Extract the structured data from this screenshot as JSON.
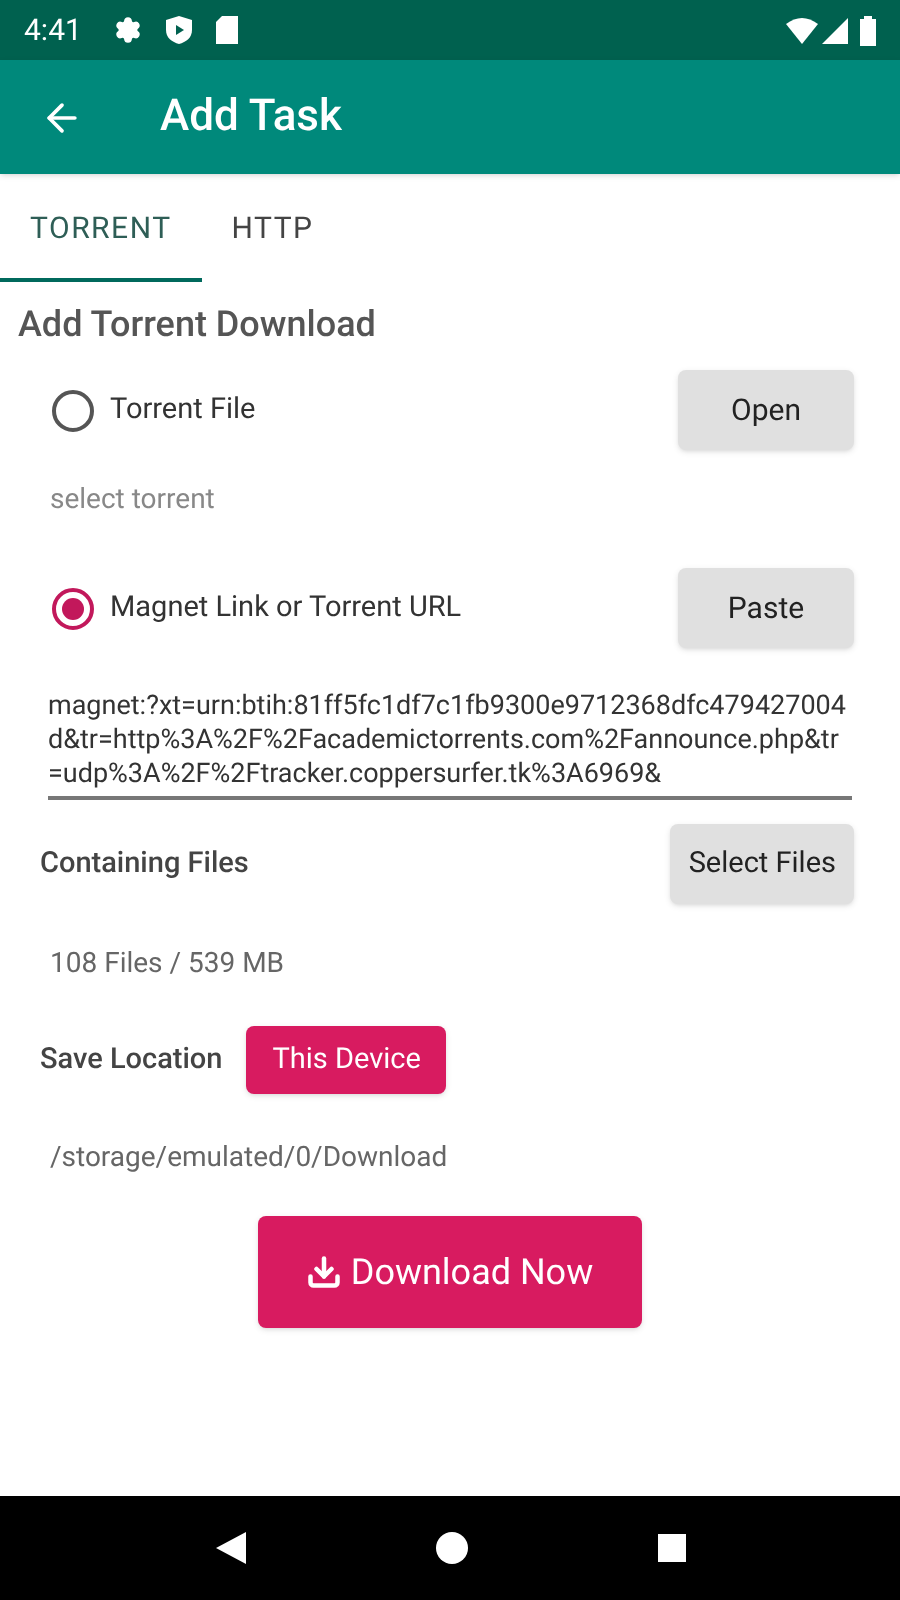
{
  "status_bar": {
    "time": "4:41"
  },
  "app_bar": {
    "title": "Add Task"
  },
  "tabs": [
    {
      "label": "TORRENT",
      "selected": true
    },
    {
      "label": "HTTP",
      "selected": false
    }
  ],
  "section_title": "Add Torrent Download",
  "sources": [
    {
      "label": "Torrent File",
      "selected": false,
      "button": "Open",
      "hint": "select torrent"
    },
    {
      "label": "Magnet Link or Torrent URL",
      "selected": true,
      "button": "Paste"
    }
  ],
  "magnet_field": {
    "value": "magnet:?xt=urn:btih:81ff5fc1df7c1fb9300e9712368dfc479427004d&tr=http%3A%2F%2Facademictorrents.com%2Fannounce.php&tr=udp%3A%2F%2Ftracker.coppersurfer.tk%3A6969&"
  },
  "containing_files": {
    "label": "Containing Files",
    "button": "Select Files",
    "summary": "108 Files / 539 MB"
  },
  "save_location": {
    "label": "Save Location",
    "button": "This Device",
    "path": "/storage/emulated/0/Download"
  },
  "download_button": "Download Now"
}
